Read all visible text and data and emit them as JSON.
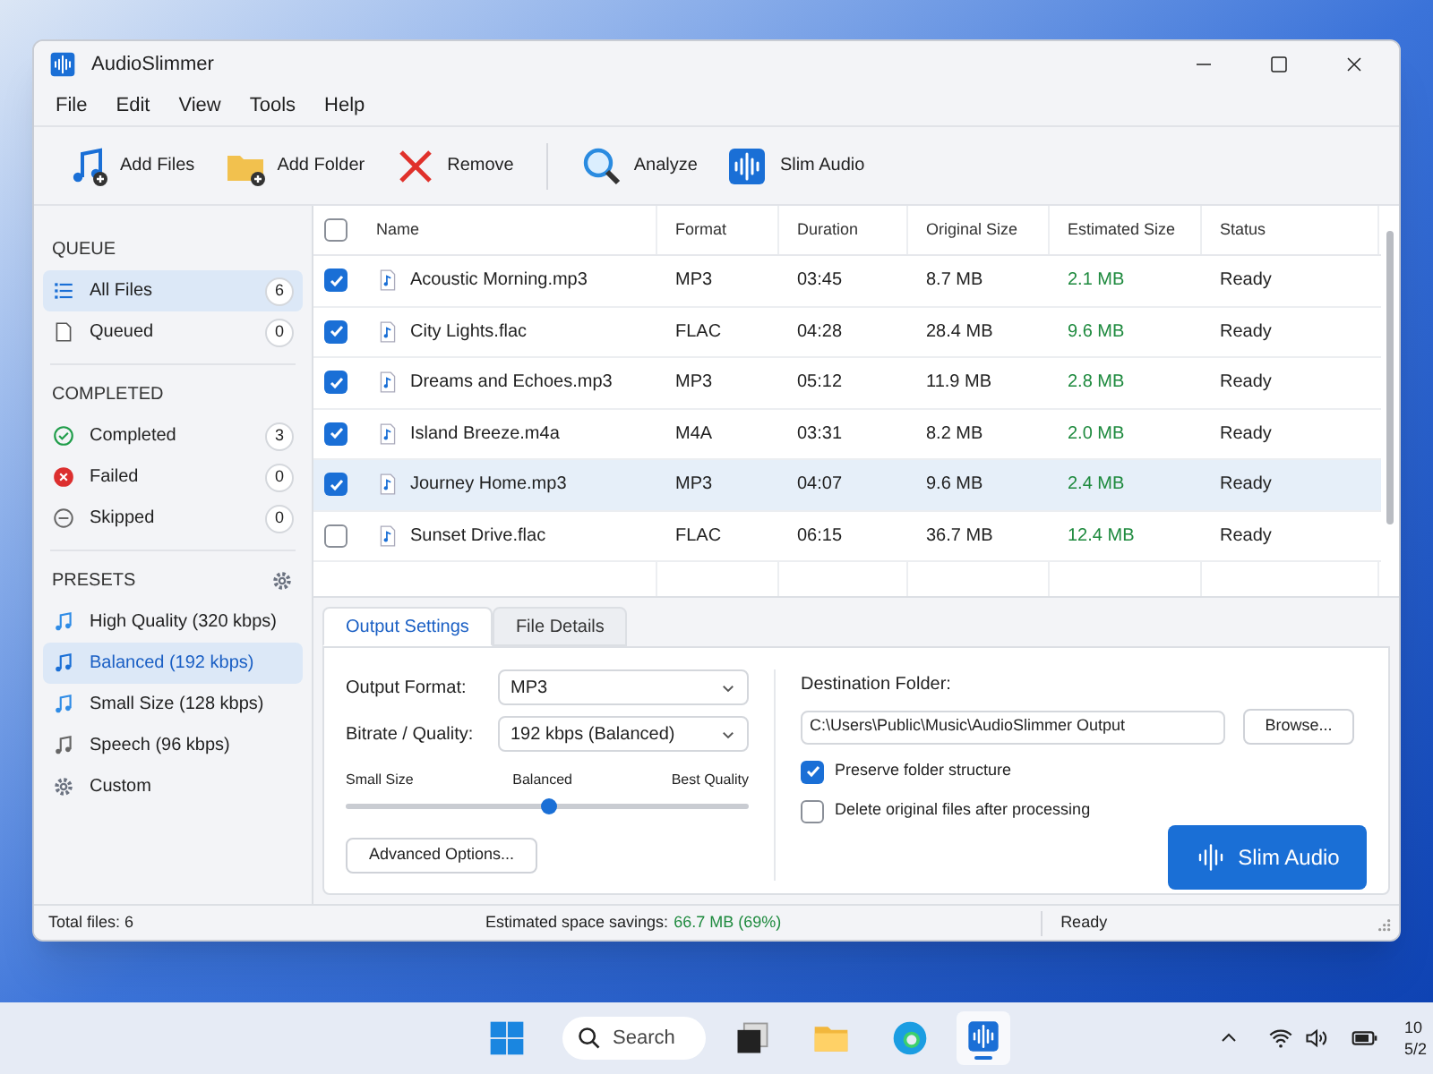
{
  "window": {
    "title": "AudioSlimmer"
  },
  "menu": [
    "File",
    "Edit",
    "View",
    "Tools",
    "Help"
  ],
  "toolbar": [
    {
      "label": "Add Files"
    },
    {
      "label": "Add Folder"
    },
    {
      "label": "Remove"
    },
    {
      "label": "Analyze"
    },
    {
      "label": "Slim Audio"
    }
  ],
  "sidebar": [
    {
      "heading": "QUEUE",
      "items": [
        {
          "label": "All Files",
          "count": "6",
          "selected": true
        },
        {
          "label": "Queued",
          "count": "0",
          "selected": false
        }
      ]
    },
    {
      "heading": "COMPLETED",
      "items": [
        {
          "label": "Completed",
          "count": "3",
          "selected": false
        },
        {
          "label": "Failed",
          "count": "0",
          "selected": false
        },
        {
          "label": "Skipped",
          "count": "0",
          "selected": false
        }
      ]
    },
    {
      "heading": "PRESETS",
      "items": [
        {
          "label": "High Quality (320 kbps)",
          "selected": false
        },
        {
          "label": "Balanced (192 kbps)",
          "selected": true
        },
        {
          "label": "Small Size (128 kbps)",
          "selected": false
        },
        {
          "label": "Speech (96 kbps)",
          "selected": false
        },
        {
          "label": "Custom",
          "selected": false
        }
      ]
    }
  ],
  "table": {
    "all_checked": false,
    "columns": [
      "Name",
      "Format",
      "Duration",
      "Original Size",
      "Estimated Size",
      "Status"
    ],
    "rows": [
      {
        "checked": true,
        "selected": false,
        "cells": [
          "Acoustic Morning.mp3",
          "MP3",
          "03:45",
          "8.7 MB",
          "2.1 MB",
          "Ready"
        ]
      },
      {
        "checked": true,
        "selected": false,
        "cells": [
          "City Lights.flac",
          "FLAC",
          "04:28",
          "28.4 MB",
          "9.6 MB",
          "Ready"
        ]
      },
      {
        "checked": true,
        "selected": false,
        "cells": [
          "Dreams and Echoes.mp3",
          "MP3",
          "05:12",
          "11.9 MB",
          "2.8 MB",
          "Ready"
        ]
      },
      {
        "checked": true,
        "selected": false,
        "cells": [
          "Island Breeze.m4a",
          "M4A",
          "03:31",
          "8.2 MB",
          "2.0 MB",
          "Ready"
        ]
      },
      {
        "checked": true,
        "selected": true,
        "cells": [
          "Journey Home.mp3",
          "MP3",
          "04:07",
          "9.6 MB",
          "2.4 MB",
          "Ready"
        ]
      },
      {
        "checked": false,
        "selected": false,
        "cells": [
          "Sunset Drive.flac",
          "FLAC",
          "06:15",
          "36.7 MB",
          "12.4 MB",
          "Ready"
        ]
      }
    ]
  },
  "tabs": [
    {
      "label": "Output Settings",
      "selected": true
    },
    {
      "label": "File Details",
      "selected": false
    }
  ],
  "settings": {
    "fields": [
      {
        "label": "Output Format:",
        "value": "MP3"
      },
      {
        "label": "Bitrate / Quality:",
        "value": "192 kbps (Balanced)"
      }
    ],
    "slider": {
      "labels": [
        "Small Size",
        "Balanced",
        "Best Quality"
      ],
      "level": 0.5
    },
    "advanced_button": "Advanced Options...",
    "destination": {
      "label": "Destination Folder:",
      "value": "C:\\Users\\Public\\Music\\AudioSlimmer Output",
      "button": "Browse..."
    },
    "options": [
      {
        "label": "Preserve folder structure",
        "checked": true
      },
      {
        "label": "Delete original files after processing",
        "checked": false
      }
    ],
    "action_button": "Slim Audio"
  },
  "status_bar": {
    "total": "Total files: 6",
    "savings_label": "Estimated space savings:",
    "savings_value": "66.7 MB (69%)",
    "state": "Ready"
  },
  "taskbar": {
    "search": "Search",
    "clock": [
      "10",
      "5/2"
    ]
  }
}
